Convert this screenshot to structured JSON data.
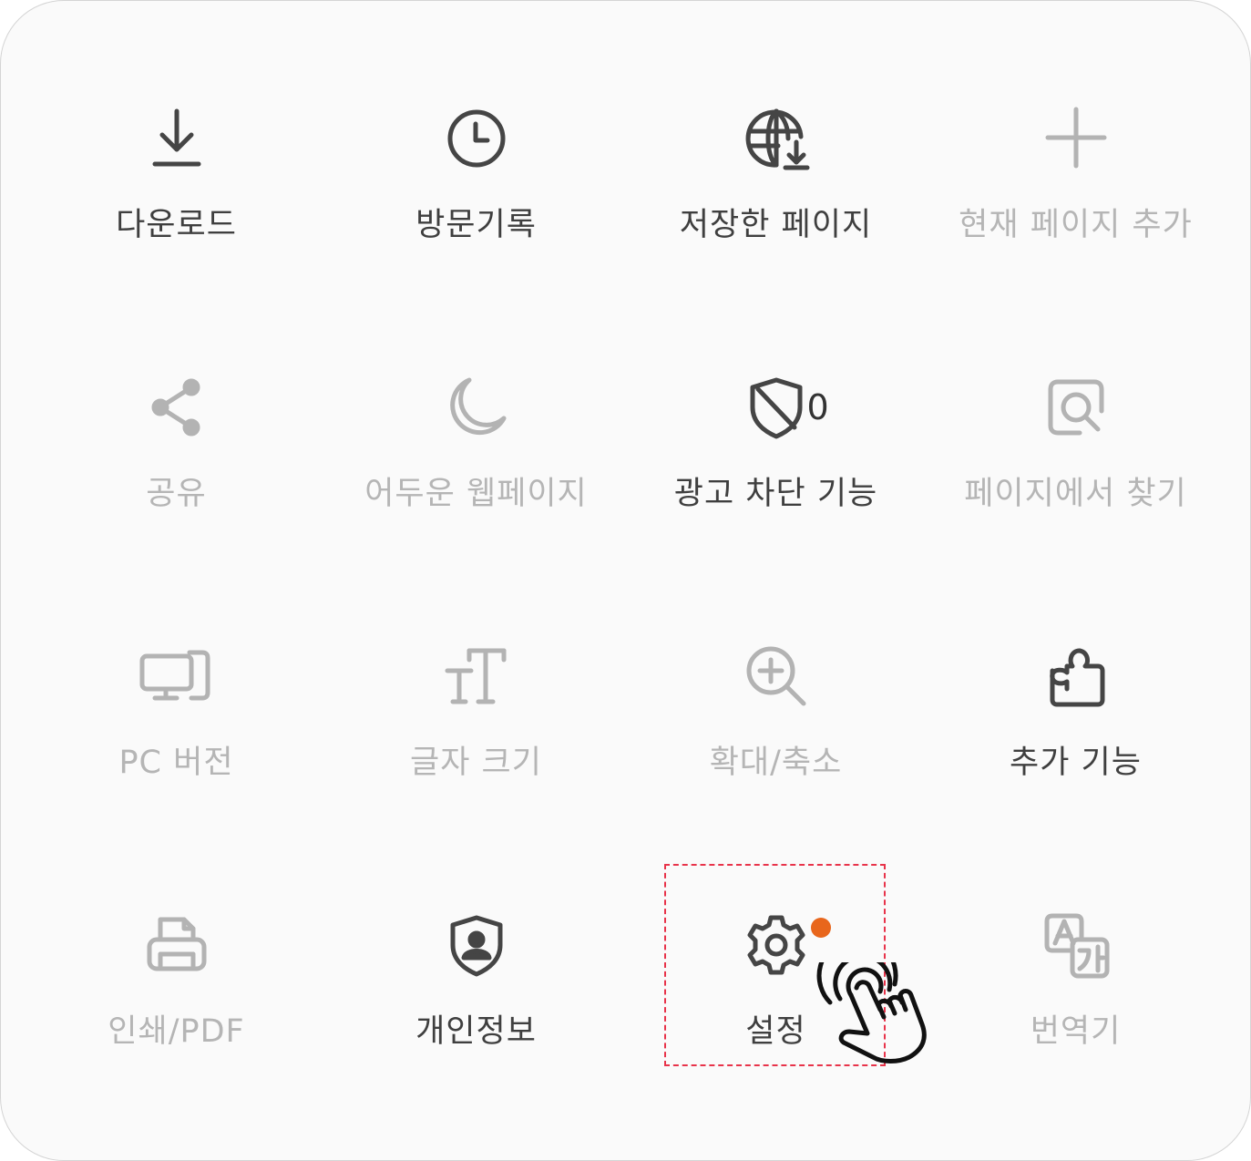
{
  "menu": {
    "accent_color": "#e8661c",
    "highlight_color": "#e8334a",
    "items": [
      {
        "label": "다운로드",
        "icon": "download-icon",
        "enabled": true
      },
      {
        "label": "방문기록",
        "icon": "history-clock-icon",
        "enabled": true
      },
      {
        "label": "저장한 페이지",
        "icon": "saved-pages-globe-icon",
        "enabled": true
      },
      {
        "label": "현재 페이지 추가",
        "icon": "plus-icon",
        "enabled": false
      },
      {
        "label": "공유",
        "icon": "share-icon",
        "enabled": false
      },
      {
        "label": "어두운 웹페이지",
        "icon": "moon-icon",
        "enabled": false
      },
      {
        "label": "광고 차단 기능",
        "icon": "ad-block-shield-icon",
        "enabled": true,
        "count": "0"
      },
      {
        "label": "페이지에서 찾기",
        "icon": "find-in-page-icon",
        "enabled": false
      },
      {
        "label": "PC 버전",
        "icon": "desktop-icon",
        "enabled": false
      },
      {
        "label": "글자 크기",
        "icon": "text-size-icon",
        "enabled": false
      },
      {
        "label": "확대/축소",
        "icon": "zoom-in-icon",
        "enabled": false
      },
      {
        "label": "추가 기능",
        "icon": "puzzle-icon",
        "enabled": true
      },
      {
        "label": "인쇄/PDF",
        "icon": "print-icon",
        "enabled": false
      },
      {
        "label": "개인정보",
        "icon": "privacy-shield-icon",
        "enabled": true
      },
      {
        "label": "설정",
        "icon": "gear-icon",
        "enabled": true,
        "notification": true,
        "highlighted": true
      },
      {
        "label": "번역기",
        "icon": "translate-icon",
        "enabled": false
      }
    ]
  },
  "overlay": {
    "cursor_icon": "tap-hand-cursor-icon"
  }
}
